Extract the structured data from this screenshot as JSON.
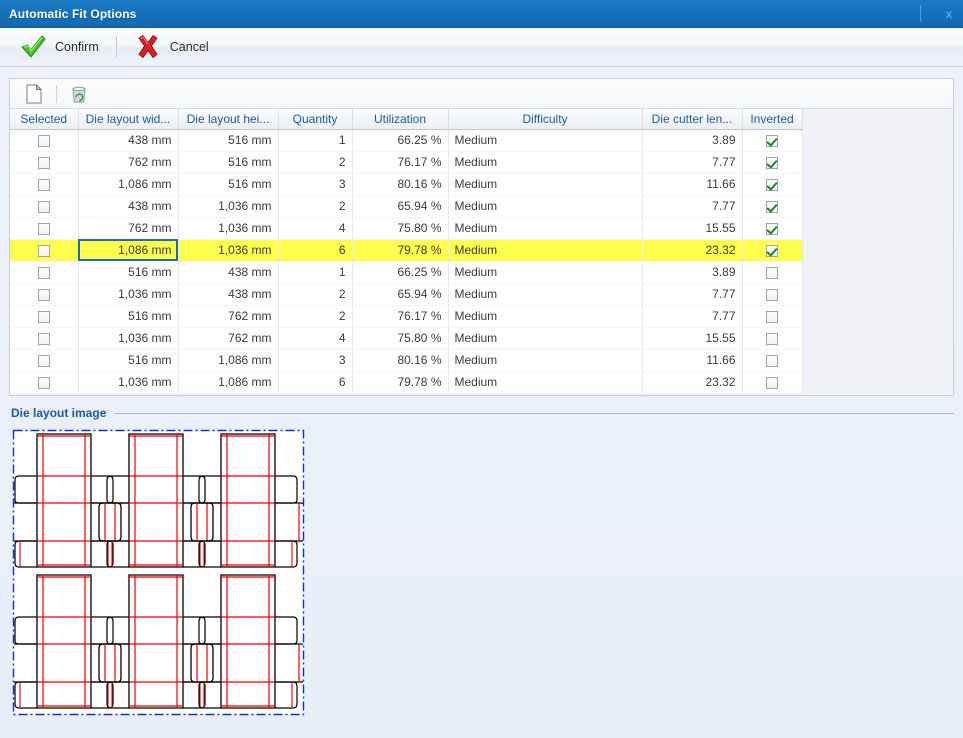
{
  "window": {
    "title": "Automatic Fit Options",
    "close_label": "x"
  },
  "command_bar": {
    "confirm_label": "Confirm",
    "cancel_label": "Cancel",
    "confirm_icon": "green-check-icon",
    "cancel_icon": "red-cross-icon"
  },
  "grid_toolbar": {
    "new_icon": "new-document-icon",
    "delete_icon": "recycle-bin-icon"
  },
  "table": {
    "columns": [
      "Selected",
      "Die layout wid...",
      "Die layout hei...",
      "Quantity",
      "Utilization",
      "Difficulty",
      "Die cutter len...",
      "Inverted"
    ],
    "rows": [
      {
        "selected": false,
        "width": "438 mm",
        "height": "516 mm",
        "quantity": "1",
        "utilization": "66.25 %",
        "difficulty": "Medium",
        "cutter_length": "3.89",
        "inverted": true,
        "highlighted": false
      },
      {
        "selected": false,
        "width": "762 mm",
        "height": "516 mm",
        "quantity": "2",
        "utilization": "76.17 %",
        "difficulty": "Medium",
        "cutter_length": "7.77",
        "inverted": true,
        "highlighted": false
      },
      {
        "selected": false,
        "width": "1,086 mm",
        "height": "516 mm",
        "quantity": "3",
        "utilization": "80.16 %",
        "difficulty": "Medium",
        "cutter_length": "11.66",
        "inverted": true,
        "highlighted": false
      },
      {
        "selected": false,
        "width": "438 mm",
        "height": "1,036 mm",
        "quantity": "2",
        "utilization": "65.94 %",
        "difficulty": "Medium",
        "cutter_length": "7.77",
        "inverted": true,
        "highlighted": false
      },
      {
        "selected": false,
        "width": "762 mm",
        "height": "1,036 mm",
        "quantity": "4",
        "utilization": "75.80 %",
        "difficulty": "Medium",
        "cutter_length": "15.55",
        "inverted": true,
        "highlighted": false
      },
      {
        "selected": false,
        "width": "1,086 mm",
        "height": "1,036 mm",
        "quantity": "6",
        "utilization": "79.78 %",
        "difficulty": "Medium",
        "cutter_length": "23.32",
        "inverted": true,
        "highlighted": true
      },
      {
        "selected": false,
        "width": "516 mm",
        "height": "438 mm",
        "quantity": "1",
        "utilization": "66.25 %",
        "difficulty": "Medium",
        "cutter_length": "3.89",
        "inverted": false,
        "highlighted": false
      },
      {
        "selected": false,
        "width": "1,036 mm",
        "height": "438 mm",
        "quantity": "2",
        "utilization": "65.94 %",
        "difficulty": "Medium",
        "cutter_length": "7.77",
        "inverted": false,
        "highlighted": false
      },
      {
        "selected": false,
        "width": "516 mm",
        "height": "762 mm",
        "quantity": "2",
        "utilization": "76.17 %",
        "difficulty": "Medium",
        "cutter_length": "7.77",
        "inverted": false,
        "highlighted": false
      },
      {
        "selected": false,
        "width": "1,036 mm",
        "height": "762 mm",
        "quantity": "4",
        "utilization": "75.80 %",
        "difficulty": "Medium",
        "cutter_length": "15.55",
        "inverted": false,
        "highlighted": false
      },
      {
        "selected": false,
        "width": "516 mm",
        "height": "1,086 mm",
        "quantity": "3",
        "utilization": "80.16 %",
        "difficulty": "Medium",
        "cutter_length": "11.66",
        "inverted": false,
        "highlighted": false
      },
      {
        "selected": false,
        "width": "1,036 mm",
        "height": "1,086 mm",
        "quantity": "6",
        "utilization": "79.78 %",
        "difficulty": "Medium",
        "cutter_length": "23.32",
        "inverted": false,
        "highlighted": false
      }
    ],
    "focused_cell": {
      "row": 5,
      "column": 1
    }
  },
  "die_layout_image": {
    "title": "Die layout image",
    "sheet_boundary_color": "#1030d0",
    "cut_line_color": "#000000",
    "crease_line_color": "#ee0000",
    "columns": 3,
    "rows": 2,
    "blanks_per_unit": 2
  },
  "colors": {
    "title_bar": "#1571bb",
    "accent_blue": "#1c5a9c",
    "highlight_row": "#ffff4d",
    "check_green": "#1a8a1a"
  }
}
